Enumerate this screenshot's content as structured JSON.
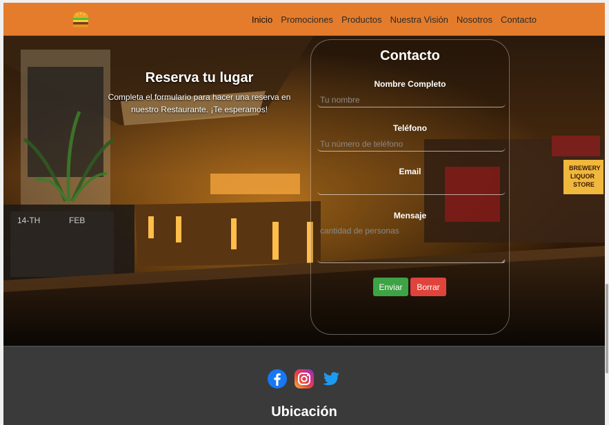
{
  "brand": {
    "logo_icon": "burger-icon"
  },
  "nav": {
    "items": [
      {
        "label": "Inicio",
        "active": true
      },
      {
        "label": "Promociones"
      },
      {
        "label": "Productos"
      },
      {
        "label": "Nuestra Visión"
      },
      {
        "label": "Nosotros"
      },
      {
        "label": "Contacto"
      }
    ]
  },
  "reserva": {
    "title": "Reserva tu lugar",
    "text": "Completa el formulario para hacer una reserva en nuestro Restaurante. ¡Te esperamos!"
  },
  "contact": {
    "title": "Contacto",
    "fields": {
      "name": {
        "label": "Nombre Completo",
        "placeholder": "Tu nombre",
        "value": ""
      },
      "phone": {
        "label": "Teléfono",
        "placeholder": "Tu número de teléfono",
        "value": ""
      },
      "email": {
        "label": "Email",
        "placeholder": "",
        "value": ""
      },
      "message": {
        "label": "Mensaje",
        "placeholder": "cantidad de personas",
        "value": ""
      }
    },
    "buttons": {
      "send": "Enviar",
      "clear": "Borrar"
    }
  },
  "footer": {
    "social_icons": [
      "facebook-icon",
      "instagram-icon",
      "twitter-icon"
    ],
    "location_title": "Ubicación"
  },
  "colors": {
    "navbar": "#e47c2b",
    "send_button": "#3da345",
    "clear_button": "#e0433c",
    "footer": "#3a3a3a"
  }
}
